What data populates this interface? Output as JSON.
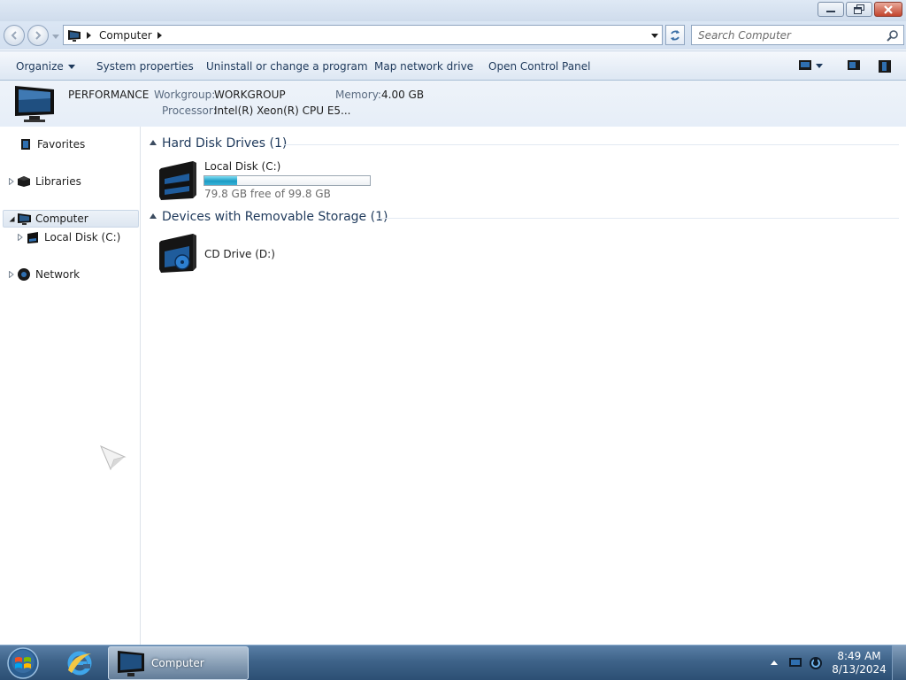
{
  "window": {
    "controls": {
      "minimize_icon": "minimize-icon",
      "restore_icon": "restore-icon",
      "close_icon": "close-icon"
    }
  },
  "address": {
    "crumb": "Computer",
    "search_placeholder": "Search Computer"
  },
  "toolbar": {
    "organize": "Organize",
    "system_properties": "System properties",
    "uninstall": "Uninstall or change a program",
    "map_drive": "Map network drive",
    "control_panel": "Open Control Panel"
  },
  "details": {
    "computer_name": "PERFORMANCE",
    "workgroup_label": "Workgroup:",
    "workgroup_value": "WORKGROUP",
    "memory_label": "Memory:",
    "memory_value": "4.00 GB",
    "processor_label": "Processor:",
    "processor_value": "Intel(R) Xeon(R) CPU E5..."
  },
  "nav": {
    "favorites": "Favorites",
    "libraries": "Libraries",
    "computer": "Computer",
    "local_disk": "Local Disk (C:)",
    "network": "Network"
  },
  "content": {
    "hdd_group": "Hard Disk Drives (1)",
    "removable_group": "Devices with Removable Storage (1)",
    "local_disk": {
      "name": "Local Disk (C:)",
      "free_text": "79.8 GB free of 99.8 GB",
      "used_fraction": 0.2
    },
    "cd_drive": {
      "name": "CD Drive (D:)"
    }
  },
  "taskbar": {
    "task_label": "Computer",
    "time": "8:49 AM",
    "date": "8/13/2024"
  },
  "colors": {
    "accent": "#1e395b",
    "bar_fill": "#1d9bc4",
    "taskbar": "#3e6389"
  }
}
